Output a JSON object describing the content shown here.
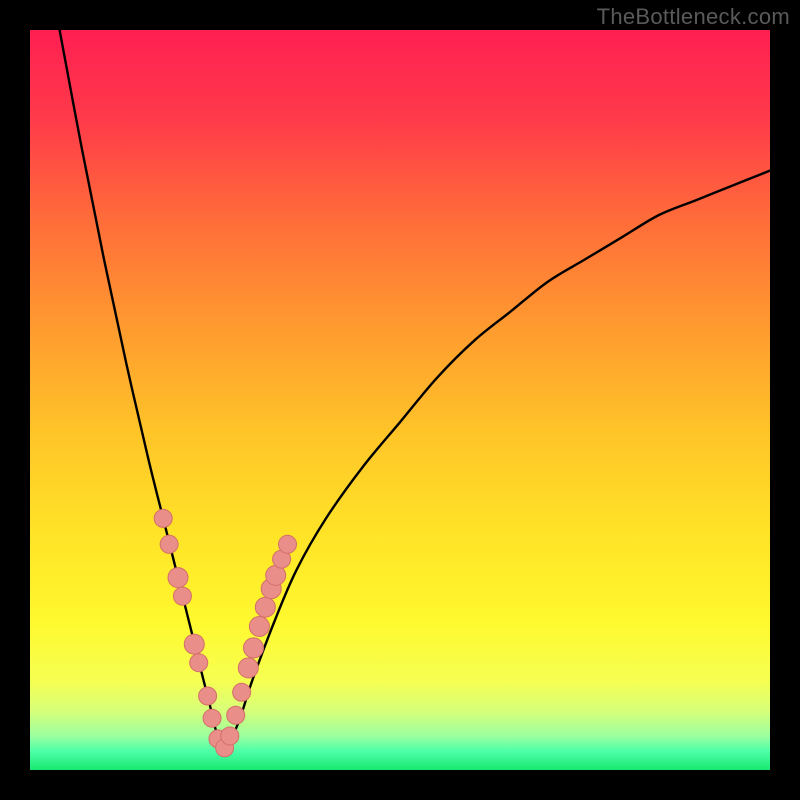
{
  "watermark": "TheBottleneck.com",
  "colors": {
    "frame": "#000000",
    "curve": "#000000",
    "marker_fill": "#e98e88",
    "marker_stroke": "#d46f69",
    "gradient_stops": [
      {
        "offset": 0,
        "color": "#ff1f52"
      },
      {
        "offset": 0.12,
        "color": "#ff3a4a"
      },
      {
        "offset": 0.25,
        "color": "#ff6a3a"
      },
      {
        "offset": 0.4,
        "color": "#ff9a2f"
      },
      {
        "offset": 0.55,
        "color": "#ffc628"
      },
      {
        "offset": 0.68,
        "color": "#ffe327"
      },
      {
        "offset": 0.8,
        "color": "#fff92e"
      },
      {
        "offset": 0.88,
        "color": "#f6ff52"
      },
      {
        "offset": 0.92,
        "color": "#d7ff7a"
      },
      {
        "offset": 0.955,
        "color": "#99ffa0"
      },
      {
        "offset": 0.975,
        "color": "#4cffa8"
      },
      {
        "offset": 1.0,
        "color": "#18e86f"
      }
    ]
  },
  "chart_data": {
    "type": "line",
    "title": "",
    "xlabel": "",
    "ylabel": "",
    "xlim": [
      0,
      100
    ],
    "ylim": [
      0,
      100
    ],
    "note": "V-shaped bottleneck curve; x is relative component scale, y is bottleneck percentage. Minimum near x≈26. Values estimated from pixels.",
    "x": [
      4,
      7,
      10,
      13,
      16,
      18,
      20,
      22,
      24,
      26,
      28,
      30,
      33,
      36,
      40,
      45,
      50,
      55,
      60,
      65,
      70,
      75,
      80,
      85,
      90,
      95,
      100
    ],
    "values": [
      100,
      84,
      69,
      55,
      42,
      34,
      26,
      18,
      10,
      3,
      6,
      12,
      20,
      27,
      34,
      41,
      47,
      53,
      58,
      62,
      66,
      69,
      72,
      75,
      77,
      79,
      81
    ],
    "markers": {
      "note": "Pink dot clusters along both branches near the minimum (estimated positions on the curve).",
      "x": [
        18.0,
        18.8,
        20.0,
        20.6,
        22.2,
        22.8,
        24.0,
        24.6,
        25.4,
        26.3,
        27.0,
        27.8,
        28.6,
        29.5,
        30.2,
        31.0,
        31.8,
        32.6,
        33.2,
        34.0,
        34.8
      ],
      "values": [
        34.0,
        30.5,
        26.0,
        23.5,
        17.0,
        14.5,
        10.0,
        7.0,
        4.2,
        3.0,
        4.6,
        7.4,
        10.5,
        13.8,
        16.5,
        19.4,
        22.0,
        24.5,
        26.3,
        28.5,
        30.5
      ],
      "r": [
        9,
        9,
        10,
        9,
        10,
        9,
        9,
        9,
        9,
        9,
        9,
        9,
        9,
        10,
        10,
        10,
        10,
        10,
        10,
        9,
        9
      ]
    }
  }
}
